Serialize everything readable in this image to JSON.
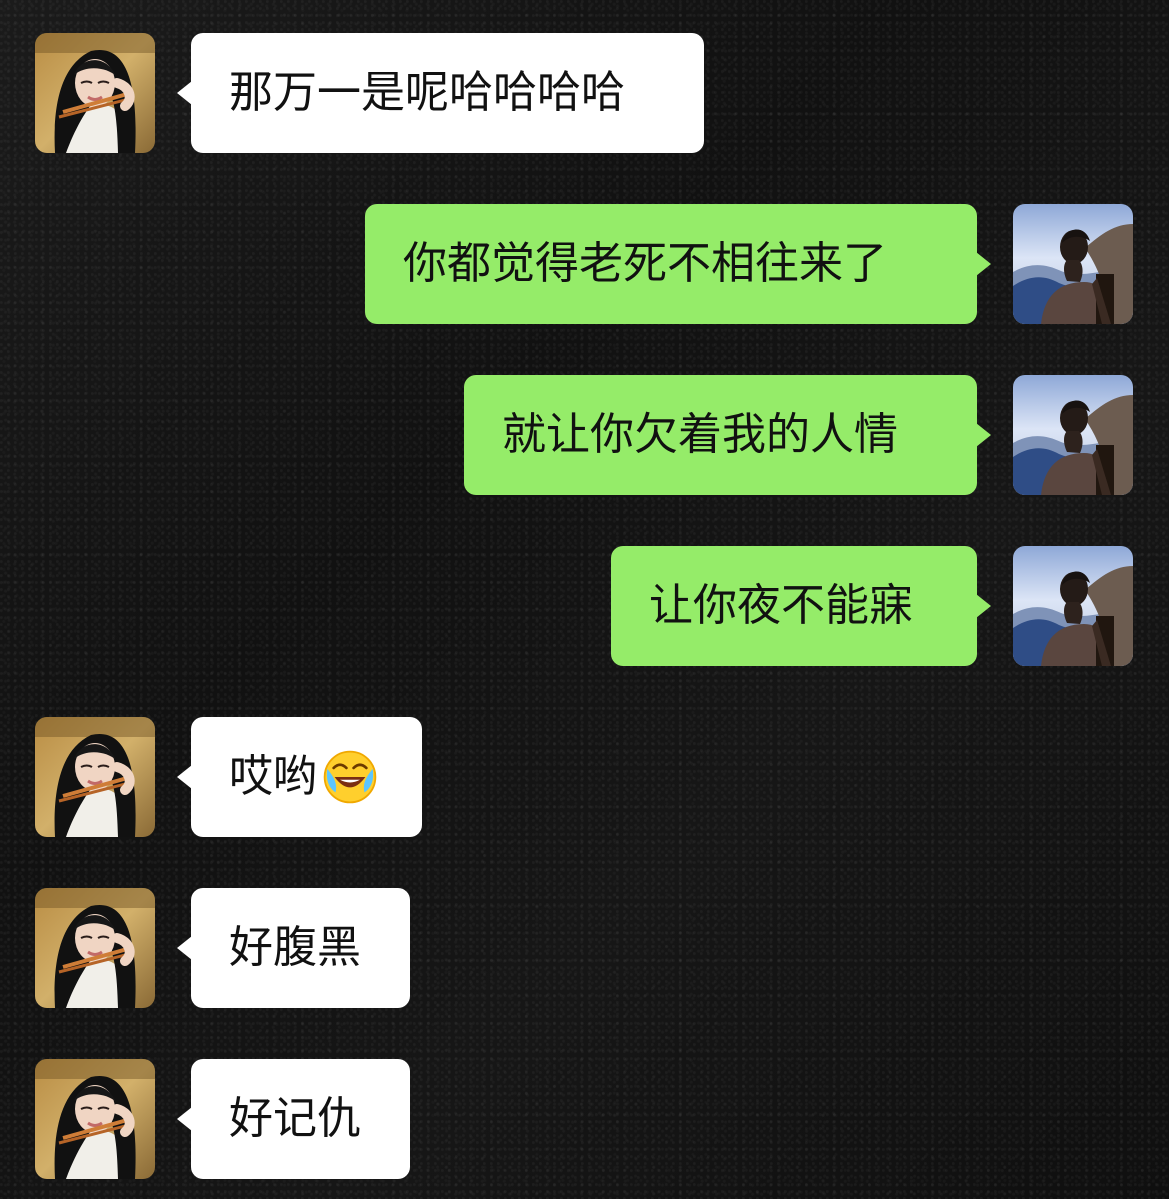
{
  "messages": [
    {
      "side": "left",
      "text": "那万一是呢哈哈哈哈",
      "avatar": "girl-avatar"
    },
    {
      "side": "right",
      "text": "你都觉得老死不相往来了",
      "avatar": "landscape-avatar"
    },
    {
      "side": "right",
      "text": "就让你欠着我的人情",
      "avatar": "landscape-avatar"
    },
    {
      "side": "right",
      "text": "让你夜不能寐",
      "avatar": "landscape-avatar"
    },
    {
      "side": "left",
      "text": "哎哟",
      "emoji": "laughing-crying-emoji",
      "avatar": "girl-avatar"
    },
    {
      "side": "left",
      "text": "好腹黑",
      "avatar": "girl-avatar"
    },
    {
      "side": "left",
      "text": "好记仇",
      "avatar": "girl-avatar"
    }
  ],
  "colors": {
    "background": "#141414",
    "left_bubble": "#ffffff",
    "right_bubble": "#95ec69",
    "text": "#111111"
  }
}
